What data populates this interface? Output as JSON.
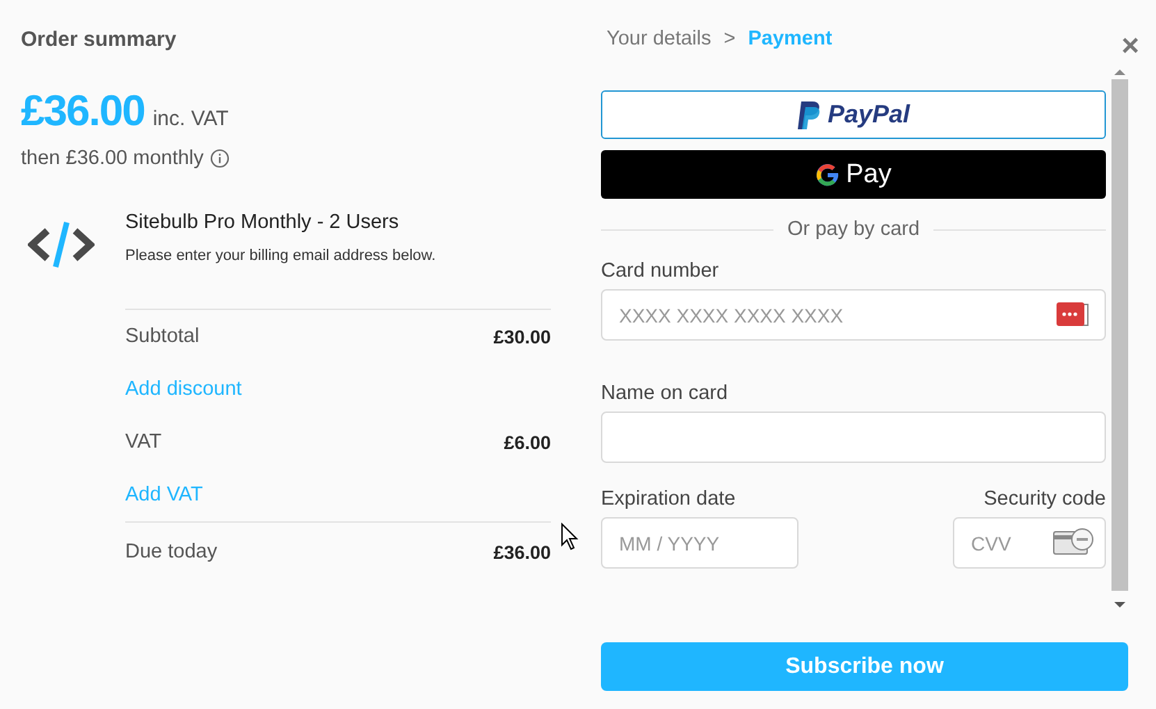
{
  "summary": {
    "title": "Order summary",
    "price": "£36.00",
    "price_note": "inc. VAT",
    "recurring": "then £36.00 monthly",
    "product": {
      "name": "Sitebulb Pro Monthly - 2 Users",
      "note": "Please enter your billing email address below."
    },
    "lines": [
      {
        "kind": "amount",
        "label": "Subtotal",
        "value": "£30.00"
      },
      {
        "kind": "link",
        "label": "Add discount"
      },
      {
        "kind": "amount",
        "label": "VAT",
        "value": "£6.00"
      },
      {
        "kind": "link",
        "label": "Add VAT"
      },
      {
        "kind": "total",
        "label": "Due today",
        "value": "£36.00"
      }
    ]
  },
  "steps": [
    {
      "label": "Your details",
      "selected": false
    },
    {
      "label": "Payment",
      "selected": true
    }
  ],
  "step_separator": ">",
  "close": "×",
  "wallets": [
    {
      "kind": "paypal",
      "label": "PayPal"
    },
    {
      "kind": "gpay",
      "label": "Pay"
    }
  ],
  "divider": "Or pay by card",
  "fields": {
    "card_number": {
      "label": "Card number",
      "placeholder": "XXXX XXXX XXXX XXXX"
    },
    "name": {
      "label": "Name on card"
    },
    "expiry": {
      "label": "Expiration date",
      "placeholder": "MM / YYYY"
    },
    "cvv": {
      "label": "Security code",
      "placeholder": "CVV"
    }
  },
  "submit": "Subscribe now"
}
